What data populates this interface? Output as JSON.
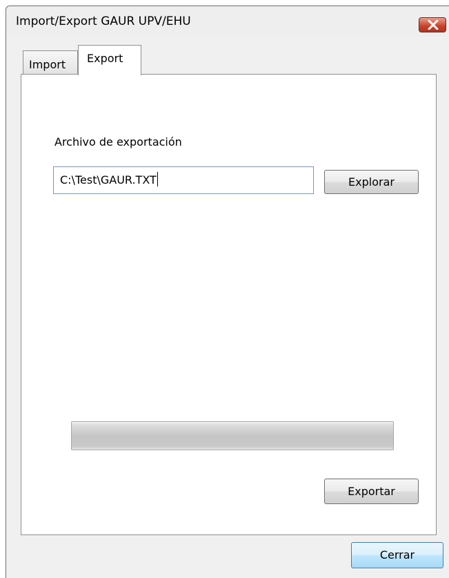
{
  "window": {
    "title": "Import/Export GAUR UPV/EHU",
    "close_icon": "close-icon"
  },
  "tabs": [
    {
      "label": "Import",
      "active": false
    },
    {
      "label": "Export",
      "active": true
    }
  ],
  "export_panel": {
    "file_label": "Archivo de exportación",
    "file_path_value": "C:\\Test\\GAUR.TXT",
    "browse_label": "Explorar",
    "progress": 0,
    "export_label": "Exportar"
  },
  "footer": {
    "close_label": "Cerrar"
  },
  "colors": {
    "close_button": "#c8412a",
    "focus_border": "#3c7fb1",
    "input_border": "#7a96c4",
    "progress_fill": "#37c837"
  }
}
